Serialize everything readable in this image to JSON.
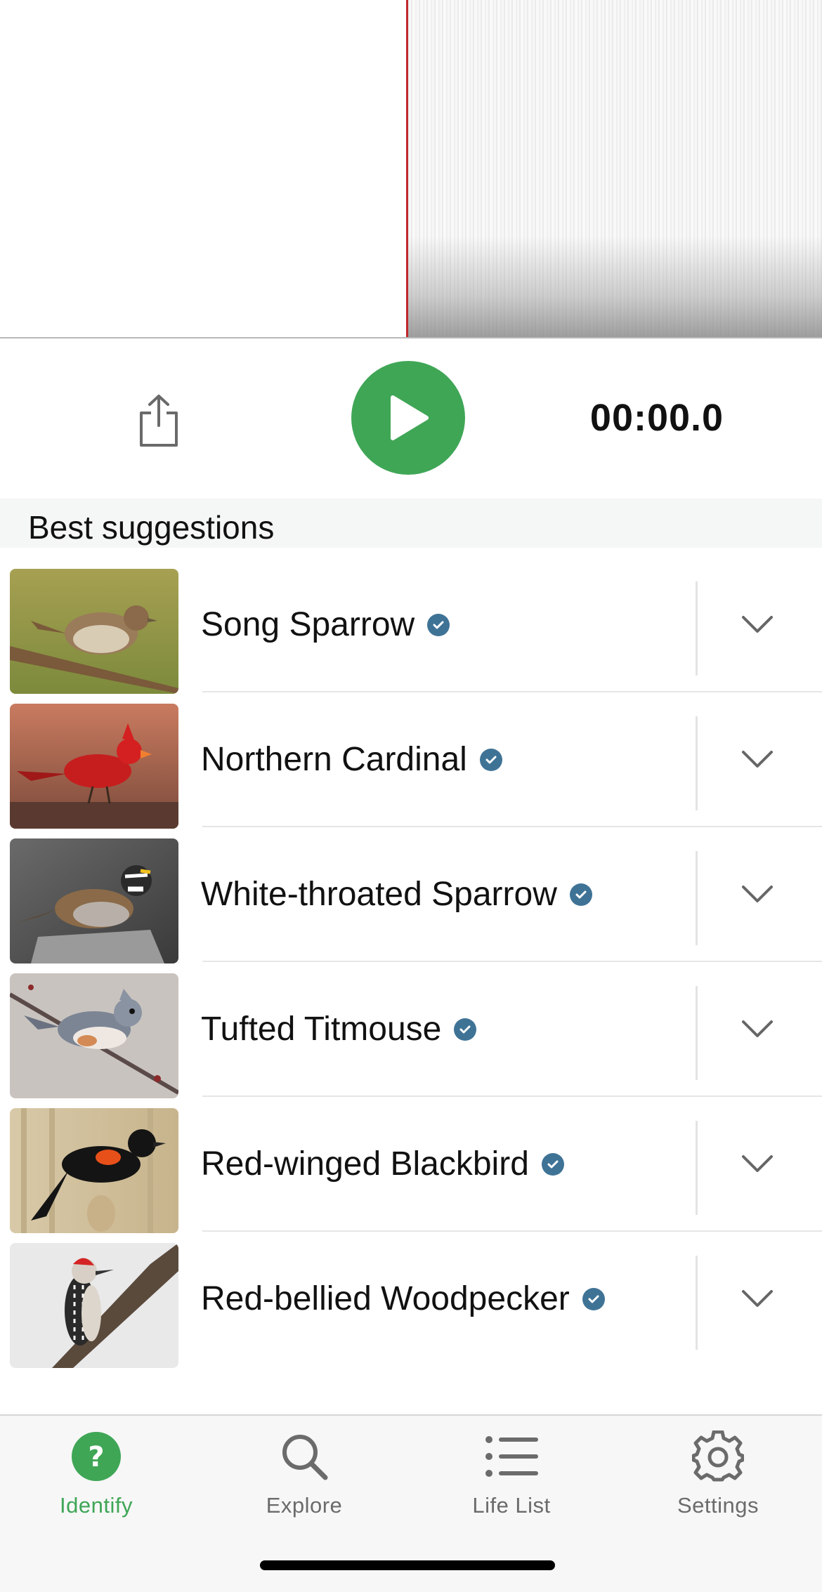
{
  "player": {
    "timer": "00:00.0"
  },
  "section": {
    "title": "Best suggestions"
  },
  "suggestions": [
    {
      "name": "Song Sparrow"
    },
    {
      "name": "Northern Cardinal"
    },
    {
      "name": "White-throated Sparrow"
    },
    {
      "name": "Tufted Titmouse"
    },
    {
      "name": "Red-winged Blackbird"
    },
    {
      "name": "Red-bellied Woodpecker"
    }
  ],
  "tabs": [
    {
      "label": "Identify",
      "icon": "question-icon",
      "active": true
    },
    {
      "label": "Explore",
      "icon": "search-icon",
      "active": false
    },
    {
      "label": "Life List",
      "icon": "list-icon",
      "active": false
    },
    {
      "label": "Settings",
      "icon": "gear-icon",
      "active": false
    }
  ],
  "colors": {
    "accent_green": "#3fa656",
    "verified_badge": "#3f7396",
    "playhead": "#c0282a"
  }
}
